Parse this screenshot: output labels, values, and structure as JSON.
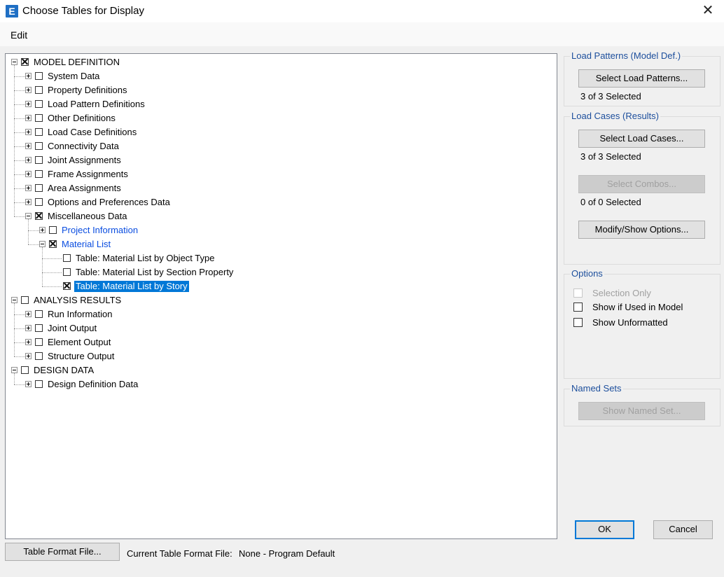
{
  "window": {
    "title": "Choose Tables for Display",
    "app_icon_letter": "E",
    "close_glyph": "✕"
  },
  "menu": {
    "items": [
      {
        "label": "Edit"
      }
    ]
  },
  "tree": {
    "nodes": [
      {
        "label": "MODEL DEFINITION",
        "depth": 0,
        "expander": "minus",
        "checked": true
      },
      {
        "label": "System Data",
        "depth": 1,
        "expander": "plus",
        "checked": false
      },
      {
        "label": "Property Definitions",
        "depth": 1,
        "expander": "plus",
        "checked": false
      },
      {
        "label": "Load Pattern Definitions",
        "depth": 1,
        "expander": "plus",
        "checked": false
      },
      {
        "label": "Other Definitions",
        "depth": 1,
        "expander": "plus",
        "checked": false
      },
      {
        "label": "Load Case Definitions",
        "depth": 1,
        "expander": "plus",
        "checked": false
      },
      {
        "label": "Connectivity Data",
        "depth": 1,
        "expander": "plus",
        "checked": false
      },
      {
        "label": "Joint Assignments",
        "depth": 1,
        "expander": "plus",
        "checked": false
      },
      {
        "label": "Frame Assignments",
        "depth": 1,
        "expander": "plus",
        "checked": false
      },
      {
        "label": "Area Assignments",
        "depth": 1,
        "expander": "plus",
        "checked": false
      },
      {
        "label": "Options and Preferences Data",
        "depth": 1,
        "expander": "plus",
        "checked": false
      },
      {
        "label": "Miscellaneous Data",
        "depth": 1,
        "expander": "minus",
        "checked": true
      },
      {
        "label": "Project Information",
        "depth": 2,
        "expander": "plus",
        "checked": false,
        "blue": true
      },
      {
        "label": "Material List",
        "depth": 2,
        "expander": "minus",
        "checked": true,
        "blue": true
      },
      {
        "label": "Table:  Material List by Object Type",
        "depth": 3,
        "expander": "none",
        "checked": false
      },
      {
        "label": "Table:  Material List by Section Property",
        "depth": 3,
        "expander": "none",
        "checked": false
      },
      {
        "label": "Table:  Material List by Story",
        "depth": 3,
        "expander": "none",
        "checked": true,
        "selected": true
      },
      {
        "label": "ANALYSIS RESULTS",
        "depth": 0,
        "expander": "minus",
        "checked": false
      },
      {
        "label": "Run Information",
        "depth": 1,
        "expander": "plus",
        "checked": false
      },
      {
        "label": "Joint Output",
        "depth": 1,
        "expander": "plus",
        "checked": false
      },
      {
        "label": "Element Output",
        "depth": 1,
        "expander": "plus",
        "checked": false
      },
      {
        "label": "Structure Output",
        "depth": 1,
        "expander": "plus",
        "checked": false
      },
      {
        "label": "DESIGN DATA",
        "depth": 0,
        "expander": "minus",
        "checked": false
      },
      {
        "label": "Design Definition Data",
        "depth": 1,
        "expander": "plus",
        "checked": false
      }
    ]
  },
  "load_patterns": {
    "title": "Load Patterns (Model Def.)",
    "select_button": "Select Load Patterns...",
    "status": "3 of 3 Selected"
  },
  "load_cases": {
    "title": "Load Cases (Results)",
    "select_button": "Select Load Cases...",
    "status": "3 of 3 Selected",
    "combos_button": "Select Combos...",
    "combos_status": "0 of 0 Selected",
    "modify_button": "Modify/Show Options..."
  },
  "options": {
    "title": "Options",
    "items": [
      {
        "label": "Selection Only",
        "checked": false,
        "disabled": true
      },
      {
        "label": "Show if Used in Model",
        "checked": false,
        "disabled": false
      },
      {
        "label": "Show Unformatted",
        "checked": false,
        "disabled": false
      }
    ]
  },
  "named_sets": {
    "title": "Named Sets",
    "button": "Show Named Set..."
  },
  "footer": {
    "ok": "OK",
    "cancel": "Cancel",
    "table_format_button": "Table Format File...",
    "current_format_label": "Current Table Format File:",
    "current_format_value": "None - Program Default"
  }
}
